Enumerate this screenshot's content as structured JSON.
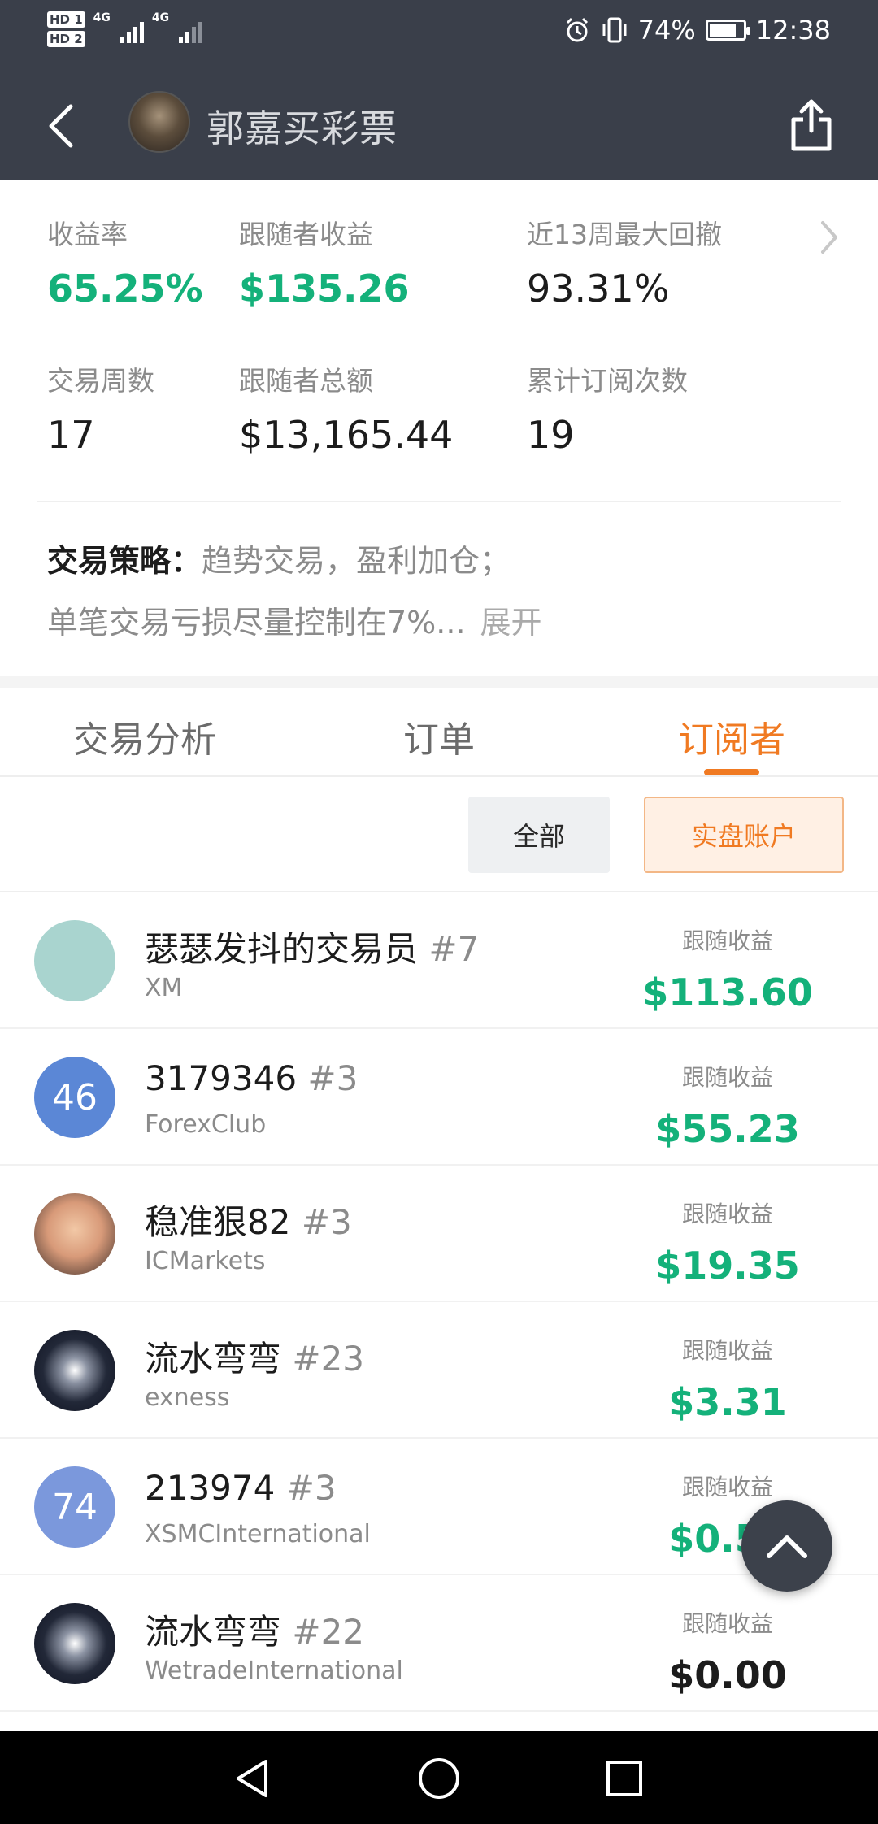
{
  "status_bar": {
    "hd1": "HD 1",
    "hd2": "HD 2",
    "net1": "4G",
    "net2": "4G",
    "battery": "74%",
    "time": "12:38"
  },
  "nav": {
    "title": "郭嘉买彩票"
  },
  "stats": {
    "return_rate": {
      "label": "收益率",
      "value": "65.25%"
    },
    "follower_profit": {
      "label": "跟随者收益",
      "value": "$135.26"
    },
    "max_drawdown": {
      "label": "近13周最大回撤",
      "value": "93.31%"
    },
    "trading_weeks": {
      "label": "交易周数",
      "value": "17"
    },
    "follower_total": {
      "label": "跟随者总额",
      "value": "$13,165.44"
    },
    "subscriptions": {
      "label": "累计订阅次数",
      "value": "19"
    }
  },
  "strategy": {
    "key": "交易策略：",
    "line1": "趋势交易，盈利加仓；",
    "line2": "单笔交易亏损尽量控制在7%...",
    "expand": "展开"
  },
  "tabs": [
    {
      "label": "交易分析",
      "active": false
    },
    {
      "label": "订单",
      "active": false
    },
    {
      "label": "订阅者",
      "active": true
    }
  ],
  "filter": {
    "all": "全部",
    "real": "实盘账户"
  },
  "subscribers": [
    {
      "name": "瑟瑟发抖的交易员",
      "rank": "#7",
      "broker": "XM",
      "profit_label": "跟随收益",
      "profit": "$113.60",
      "avatar": "bear",
      "avatar_text": ""
    },
    {
      "name": "3179346",
      "rank": "#3",
      "broker": "ForexClub",
      "profit_label": "跟随收益",
      "profit": "$55.23",
      "avatar": "num1",
      "avatar_text": "46"
    },
    {
      "name": "稳准狠82",
      "rank": "#3",
      "broker": "ICMarkets",
      "profit_label": "跟随收益",
      "profit": "$19.35",
      "avatar": "face",
      "avatar_text": ""
    },
    {
      "name": "流水弯弯",
      "rank": "#23",
      "broker": "exness",
      "profit_label": "跟随收益",
      "profit": "$3.31",
      "avatar": "yin",
      "avatar_text": ""
    },
    {
      "name": "213974",
      "rank": "#3",
      "broker": "XSMCInternational",
      "profit_label": "跟随收益",
      "profit": "$0.58",
      "avatar": "num2",
      "avatar_text": "74"
    },
    {
      "name": "流水弯弯",
      "rank": "#22",
      "broker": "WetradeInternational",
      "profit_label": "跟随收益",
      "profit": "$0.00",
      "avatar": "yin",
      "avatar_text": ""
    }
  ],
  "colors": {
    "header_bg": "#3a3f4a",
    "profit_green": "#14b17a",
    "accent_orange": "#f07a22"
  }
}
